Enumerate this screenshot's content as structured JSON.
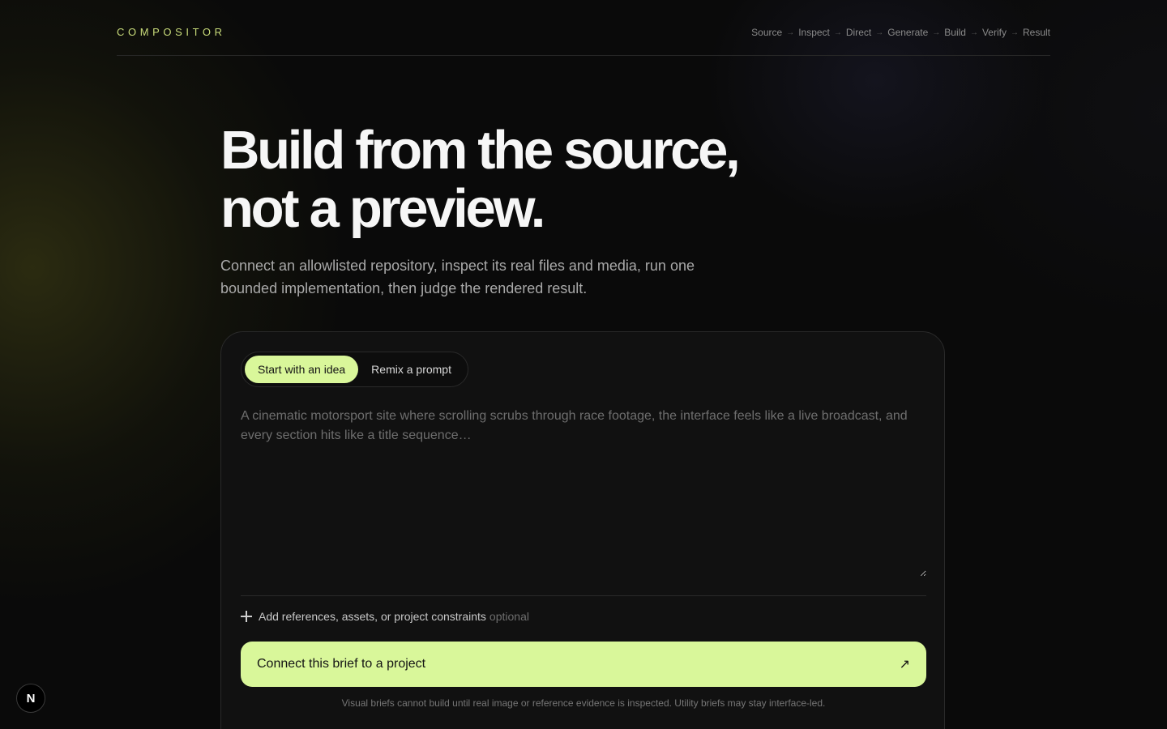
{
  "brand": {
    "name": "COMPOSITOR"
  },
  "nav": {
    "steps": [
      "Source",
      "Inspect",
      "Direct",
      "Generate",
      "Build",
      "Verify",
      "Result"
    ],
    "separator": "→"
  },
  "hero": {
    "title_line1": "Build from the source,",
    "title_line2": "not a preview.",
    "subtitle": "Connect an allowlisted repository, inspect its real files and media, run one bounded implementation, then judge the rendered result."
  },
  "composer": {
    "tabs": [
      {
        "label": "Start with an idea",
        "active": true
      },
      {
        "label": "Remix a prompt",
        "active": false
      }
    ],
    "brief_value": "",
    "brief_placeholder": "A cinematic motorsport site where scrolling scrubs through race footage, the interface feels like a live broadcast, and every section hits like a title sequence…",
    "add_refs_label": "Add references, assets, or project constraints",
    "add_refs_optional": "optional",
    "cta_label": "Connect this brief to a project",
    "cta_icon": "arrow-up-right-icon",
    "cta_glyph": "↗",
    "footnote": "Visual briefs cannot build until real image or reference evidence is inspected. Utility briefs may stay interface-led."
  },
  "corner_logo": {
    "glyph": "N",
    "icon": "nextjs-logo-icon"
  },
  "colors": {
    "accent": "#d9f79a",
    "brand": "#c9dc7a",
    "background": "#0a0a0a",
    "card": "#111111"
  }
}
